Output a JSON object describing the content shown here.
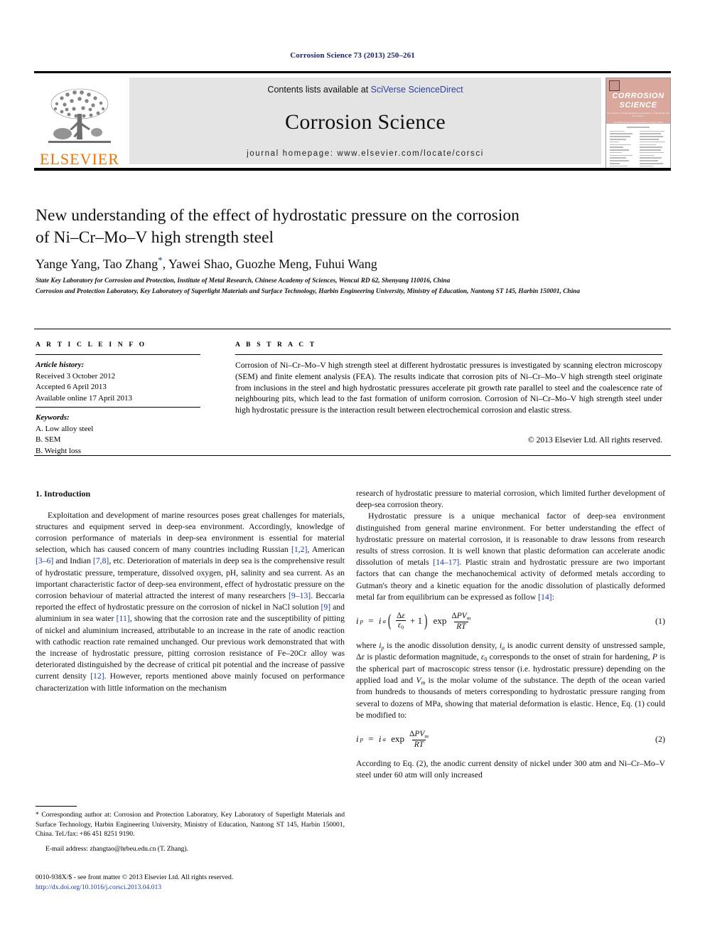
{
  "running_head": "Corrosion Science 73 (2013) 250–261",
  "masthead": {
    "publisher_wordmark": "ELSEVIER",
    "contents_prefix": "Contents lists available at ",
    "contents_link": "SciVerse ScienceDirect",
    "journal_title": "Corrosion Science",
    "homepage": "journal homepage: www.elsevier.com/locate/corsci",
    "cover": {
      "line1": "CORROSION",
      "line2": "SCIENCE",
      "tagline": "The Journal on Environmental Degradation of Materials and its Control",
      "tagline2": "An Official Journal of the International Corrosion Council"
    },
    "accent_orange": "#ec7404",
    "link_blue": "#2b3f9e",
    "cover_salmon": "#d9a79c"
  },
  "article": {
    "title_line1": "New understanding of the effect of hydrostatic pressure on the corrosion",
    "title_line2": "of Ni–Cr–Mo–V high strength steel",
    "authors": "Yange Yang, Tao Zhang",
    "authors_rest": ", Yawei Shao, Guozhe Meng, Fuhui Wang",
    "corresponding_marker": "*",
    "affiliation_a": "State Key Laboratory for Corrosion and Protection, Institute of Metal Research, Chinese Academy of Sciences, Wencui RD 62, Shenyang 110016, China",
    "affiliation_b": "Corrosion and Protection Laboratory, Key Laboratory of Superlight Materials and Surface Technology, Harbin Engineering University, Ministry of Education, Nantong ST 145, Harbin 150001, China"
  },
  "info_panel": {
    "heading": "A R T I C L E    I N F O",
    "history_label": "Article history:",
    "history": [
      "Received 3 October 2012",
      "Accepted 6 April 2013",
      "Available online 17 April 2013"
    ],
    "keywords_label": "Keywords:",
    "keywords": [
      "A. Low alloy steel",
      "B. SEM",
      "B. Weight loss"
    ]
  },
  "abstract_panel": {
    "heading": "A B S T R A C T",
    "text": "Corrosion of Ni–Cr–Mo–V high strength steel at different hydrostatic pressures is investigated by scanning electron microscopy (SEM) and finite element analysis (FEA). The results indicate that corrosion pits of Ni–Cr–Mo–V high strength steel originate from inclusions in the steel and high hydrostatic pressures accelerate pit growth rate parallel to steel and the coalescence rate of neighbouring pits, which lead to the fast formation of uniform corrosion. Corrosion of Ni–Cr–Mo–V high strength steel under high hydrostatic pressure is the interaction result between electrochemical corrosion and elastic stress.",
    "copyright": "© 2013 Elsevier Ltd. All rights reserved."
  },
  "body": {
    "section_heading": "1. Introduction",
    "left_p1_a": "Exploitation and development of marine resources poses great challenges for materials, structures and equipment served in deep-sea environment. Accordingly, knowledge of corrosion performance of materials in deep-sea environment is essential for material selection, which has caused concern of many countries including Russian ",
    "ref_1_2": "[1,2]",
    "left_p1_b": ", American ",
    "ref_3_6": "[3–6]",
    "left_p1_c": " and Indian ",
    "ref_7_8": "[7,8]",
    "left_p1_d": ", etc. Deterioration of materials in deep sea is the comprehensive result of hydrostatic pressure, temperature, dissolved oxygen, pH, salinity and sea current. As an important characteristic factor of deep-sea environment, effect of hydrostatic pressure on the corrosion behaviour of material attracted the interest of many researchers ",
    "ref_9_13": "[9–13]",
    "left_p1_e": ". Beccaria reported the effect of hydrostatic pressure on the corrosion of nickel in NaCl solution ",
    "ref_9": "[9]",
    "left_p1_f": " and aluminium in sea water ",
    "ref_11": "[11]",
    "left_p1_g": ", showing that the corrosion rate and the susceptibility of pitting of nickel and aluminium increased, attributable to an increase in the rate of anodic reaction with cathodic reaction rate remained unchanged. Our previous work demonstrated that with the increase of hydrostatic pressure, pitting corrosion resistance of Fe–20Cr alloy was deteriorated distinguished by the decrease of critical pit potential and the increase of passive current density ",
    "ref_12": "[12]",
    "left_p1_h": ". However, reports mentioned above mainly focused on performance characterization with little information on the mechanism",
    "right_p1": "research of hydrostatic pressure to material corrosion, which limited further development of deep-sea corrosion theory.",
    "right_p2_a": "Hydrostatic pressure is a unique mechanical factor of deep-sea environment distinguished from general marine environment. For better understanding the effect of hydrostatic pressure on material corrosion, it is reasonable to draw lessons from research results of stress corrosion. It is well known that plastic deformation can accelerate anodic dissolution of metals ",
    "ref_14_17": "[14–17]",
    "right_p2_b": ". Plastic strain and hydrostatic pressure are two important factors that can change the mechanochemical activity of deformed metals according to Gutman's theory and a kinetic equation for the anodic dissolution of plastically deformed metal far from equilibrium can be expressed as follow ",
    "ref_14": "[14]",
    "right_p2_c": ":",
    "eq1_number": "(1)",
    "right_p3": "where ip is the anodic dissolution density, ia is anodic current density of unstressed sample, Δε is plastic deformation magnitude, ε0 corresponds to the onset of strain for hardening, P is the spherical part of macroscopic stress tensor (i.e. hydrostatic pressure) depending on the applied load and Vm is the molar volume of the substance. The depth of the ocean varied from hundreds to thousands of meters corresponding to hydrostatic pressure ranging from several to dozens of MPa, showing that material deformation is elastic. Hence, Eq. (1) could be modified to:",
    "eq2_number": "(2)",
    "right_p4": "According to Eq. (2), the anodic current density of nickel under 300 atm and Ni–Cr–Mo–V steel under 60 atm will only increased"
  },
  "equations": {
    "eq1_latex": "i_p = i_a ( Δε/ε_0 + 1 ) exp ΔPV_m / RT",
    "eq2_latex": "i_p = i_a exp ΔPV_m / RT",
    "symbols": {
      "i": "i",
      "sub_p": "p",
      "sub_a": "a",
      "equals": "=",
      "delta": "Δ",
      "epsilon": "ε",
      "sub_zero": "0",
      "plus_one": "+ 1",
      "exp": "exp",
      "PV": "PV",
      "sub_m": "m",
      "RT": "RT"
    }
  },
  "footnotes": {
    "corresponding_star": "*",
    "corresponding_text": " Corresponding author at: Corrosion and Protection Laboratory, Key Laboratory of Superlight Materials and Surface Technology, Harbin Engineering University, Ministry of Education, Nantong ST 145, Harbin 150001, China. Tel./fax: +86 451 8251 9190.",
    "email_label": "E-mail address:",
    "email": " zhangtao@hrbeu.edu.cn",
    "email_owner": " (T. Zhang).",
    "issn_line": "0010-938X/$ - see front matter © 2013 Elsevier Ltd. All rights reserved.",
    "doi": "http://dx.doi.org/10.1016/j.corsci.2013.04.013"
  }
}
